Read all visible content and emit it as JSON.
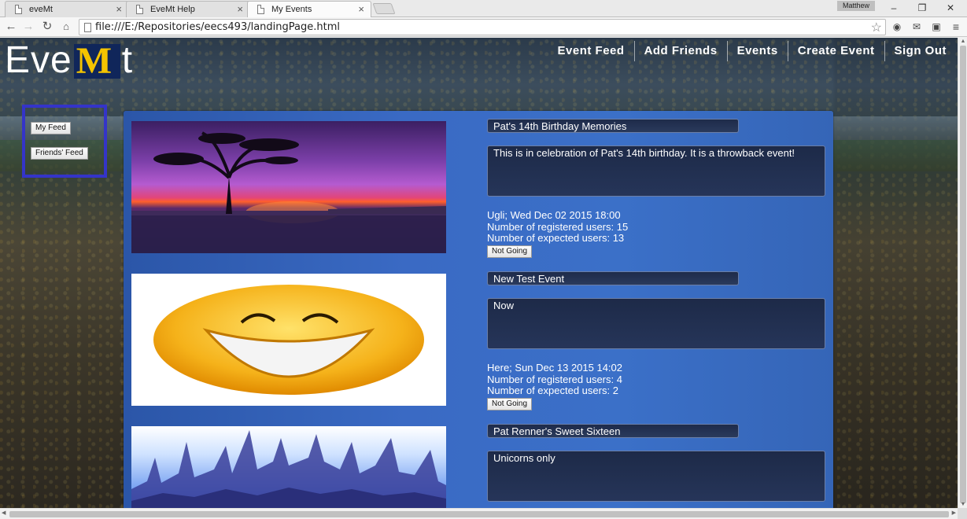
{
  "browser": {
    "tabs": [
      {
        "label": "eveMt"
      },
      {
        "label": "EveMt Help"
      },
      {
        "label": "My Events"
      }
    ],
    "profile": "Matthew",
    "url": "file:///E:/Repositories/eecs493/landingPage.html"
  },
  "site": {
    "logo_left": "Eve",
    "logo_m": "M",
    "logo_right": "t",
    "nav": [
      "Event Feed",
      "Add Friends",
      "Events",
      "Create Event",
      "Sign Out"
    ],
    "side_buttons": {
      "my_feed": "My Feed",
      "friends_feed": "Friends' Feed"
    }
  },
  "events": [
    {
      "title": "Pat's 14th Birthday Memories",
      "description": "This is in celebration of Pat's 14th birthday. It is a throwback event!",
      "location_time": "Ugli; Wed Dec 02 2015 18:00",
      "registered": "Number of registered users: 15",
      "expected": "Number of expected users: 13",
      "button": "Not Going"
    },
    {
      "title": "New Test Event",
      "description": "Now",
      "location_time": "Here; Sun Dec 13 2015 14:02",
      "registered": "Number of registered users: 4",
      "expected": "Number of expected users: 2",
      "button": "Not Going"
    },
    {
      "title": "Pat Renner's Sweet Sixteen",
      "description": "Unicorns only"
    }
  ],
  "colors": {
    "side_panel_border": "#3434c8",
    "content_panel": "#3a6ac4",
    "logo_block": "#10265a",
    "logo_maize": "#f5c400"
  }
}
